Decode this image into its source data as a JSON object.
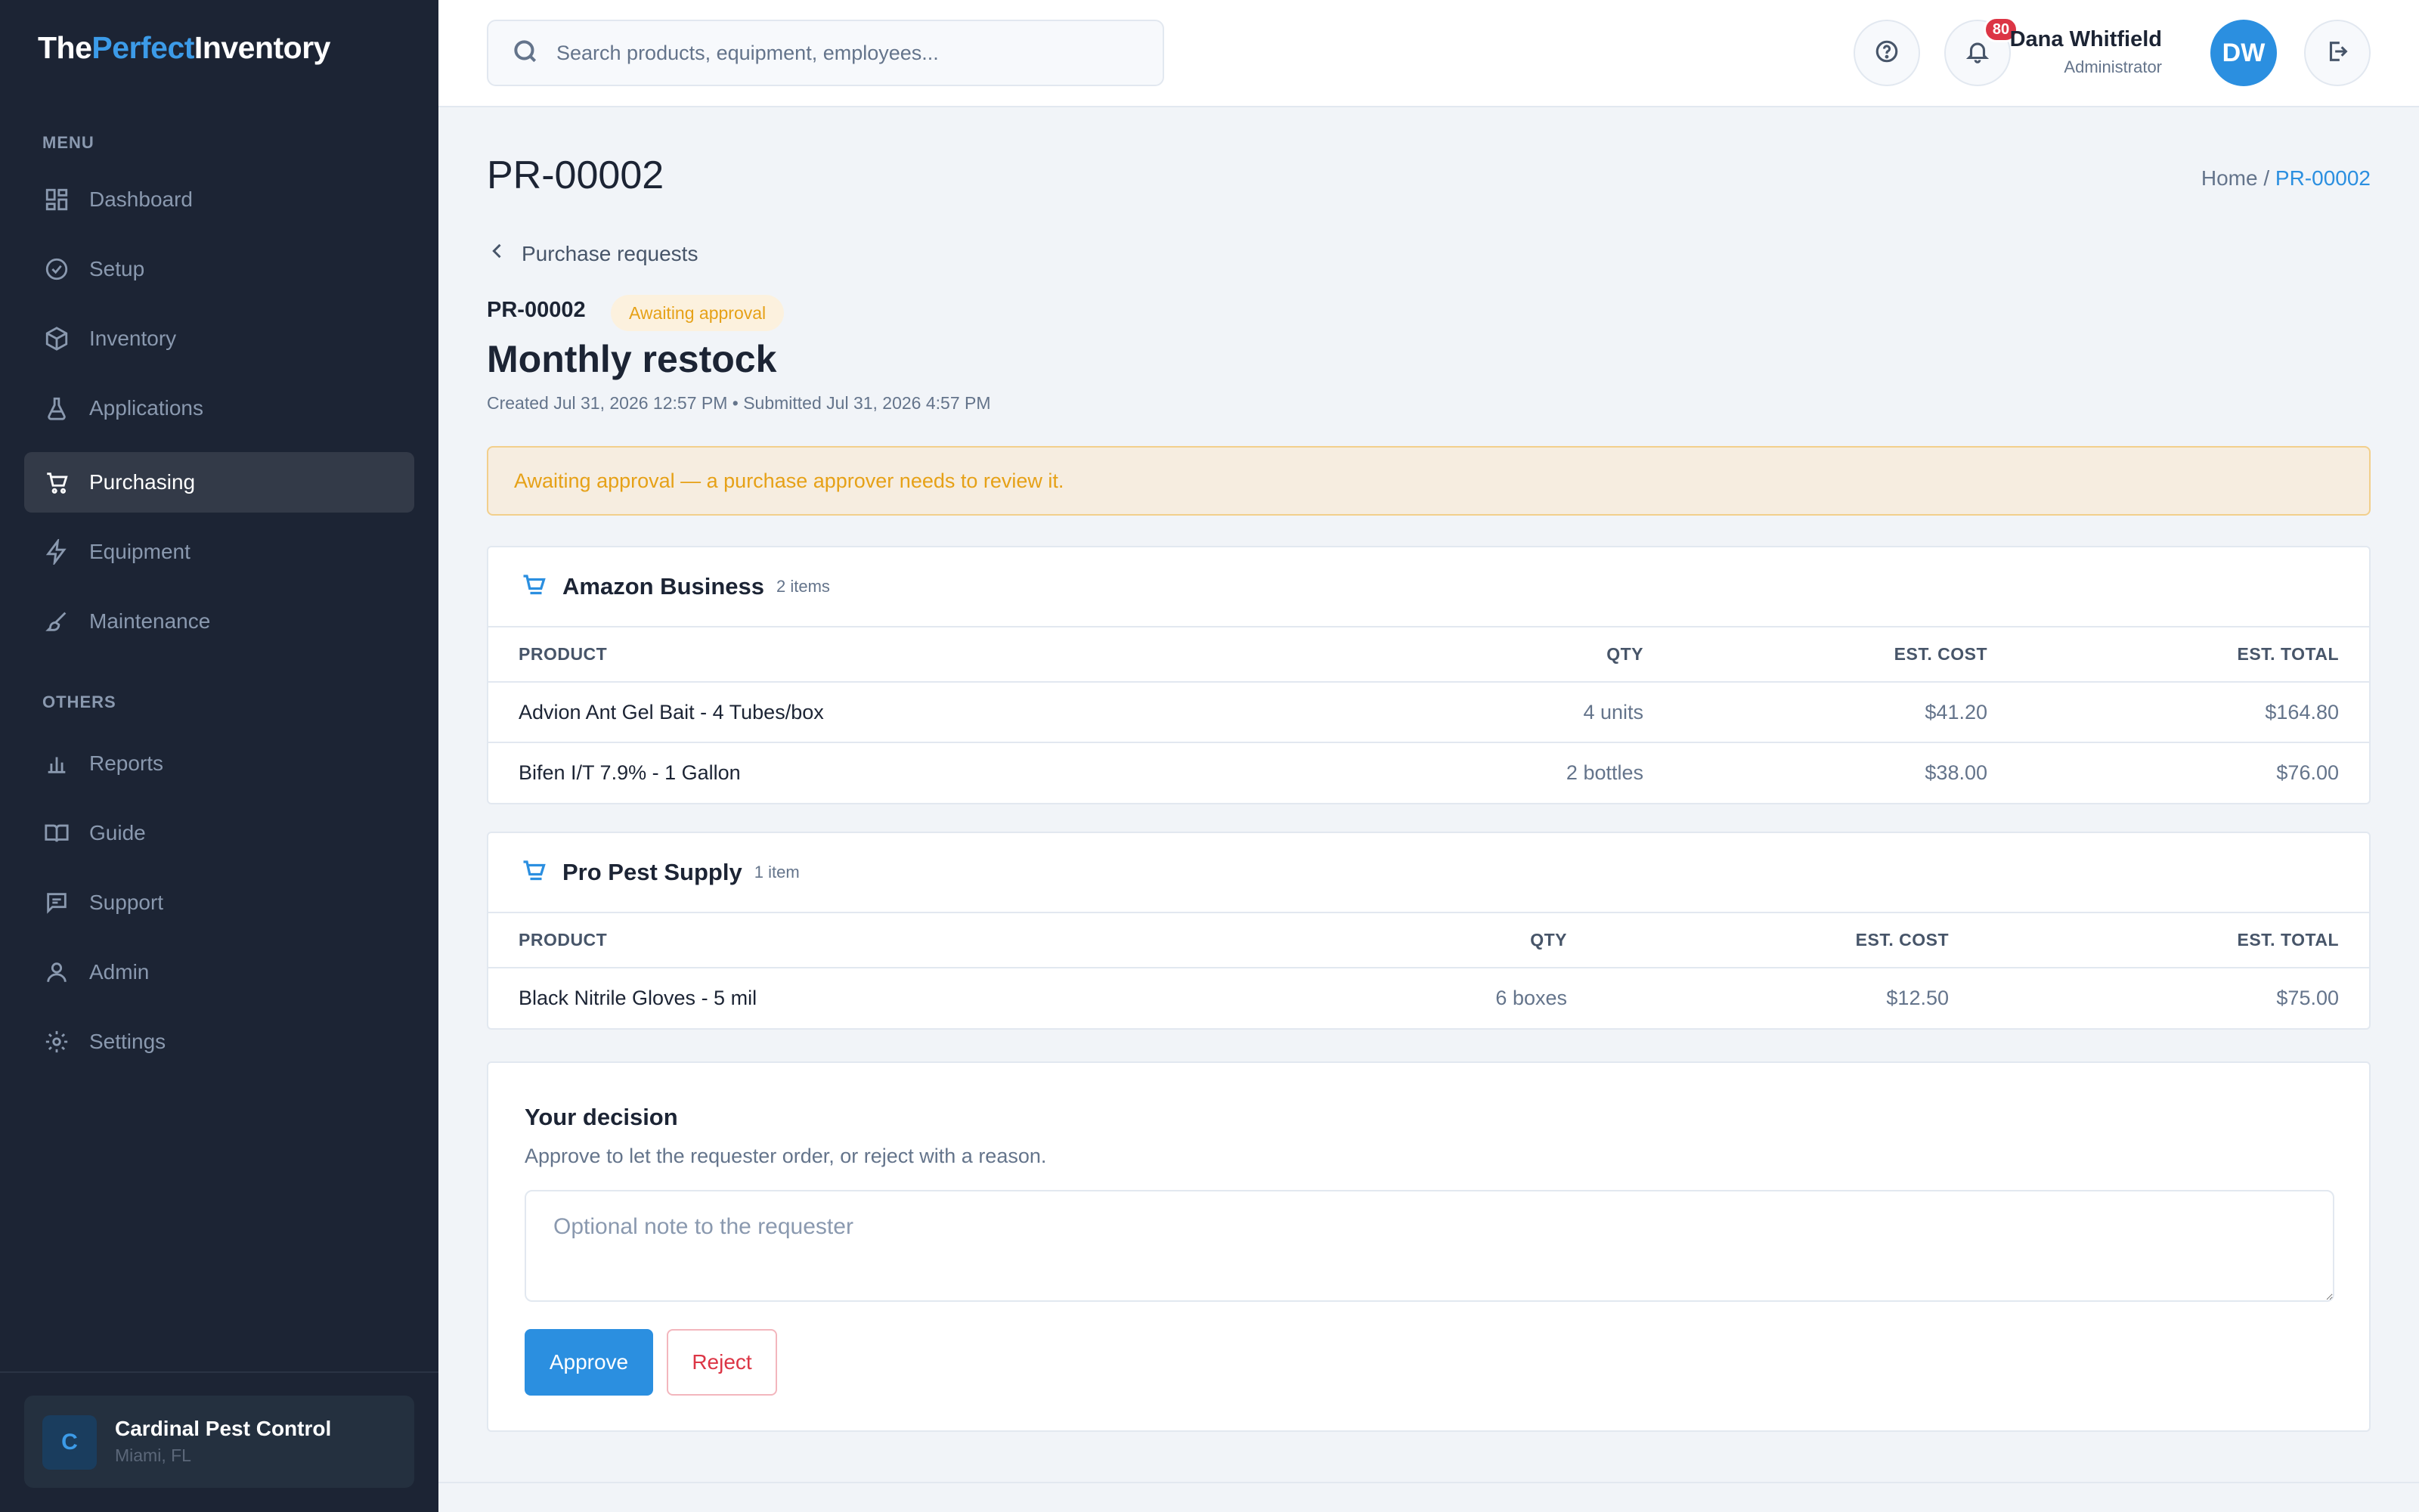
{
  "brand": {
    "part1": "The",
    "part2": "Perfect",
    "part3": "Inventory"
  },
  "sidebar": {
    "menu_label": "MENU",
    "others_label": "OTHERS",
    "items": [
      {
        "label": "Dashboard",
        "icon": "dashboard-icon"
      },
      {
        "label": "Setup",
        "icon": "check-circle-icon"
      },
      {
        "label": "Inventory",
        "icon": "box-icon"
      },
      {
        "label": "Applications",
        "icon": "flask-icon"
      },
      {
        "label": "Purchasing",
        "icon": "cart-icon",
        "active": true
      },
      {
        "label": "Equipment",
        "icon": "lightning-icon"
      },
      {
        "label": "Maintenance",
        "icon": "brush-icon"
      }
    ],
    "others": [
      {
        "label": "Reports",
        "icon": "bar-chart-icon"
      },
      {
        "label": "Guide",
        "icon": "book-icon"
      },
      {
        "label": "Support",
        "icon": "message-icon"
      },
      {
        "label": "Admin",
        "icon": "user-icon"
      },
      {
        "label": "Settings",
        "icon": "gear-icon"
      }
    ],
    "org": {
      "initial": "C",
      "name": "Cardinal Pest Control",
      "location": "Miami, FL"
    }
  },
  "header": {
    "search_placeholder": "Search products, equipment, employees...",
    "notifications_count": "80",
    "user_name": "Dana Whitfield",
    "user_role": "Administrator",
    "user_initials": "DW"
  },
  "page": {
    "title": "PR-00002",
    "breadcrumb_home": "Home /",
    "breadcrumb_current": "PR-00002",
    "back_label": "Purchase requests",
    "pr_code": "PR-00002",
    "status": "Awaiting approval",
    "request_title": "Monthly restock",
    "meta": "Created Jul 31, 2026 12:57 PM • Submitted Jul 31, 2026 4:57 PM",
    "alert": "Awaiting approval — a purchase approver needs to review it."
  },
  "vendors": [
    {
      "name": "Amazon Business",
      "count": "2 items",
      "columns": [
        "PRODUCT",
        "QTY",
        "EST. COST",
        "EST. TOTAL"
      ],
      "rows": [
        [
          "Advion Ant Gel Bait - 4 Tubes/box",
          "4 units",
          "$41.20",
          "$164.80"
        ],
        [
          "Bifen I/T 7.9% - 1 Gallon",
          "2 bottles",
          "$38.00",
          "$76.00"
        ]
      ]
    },
    {
      "name": "Pro Pest Supply",
      "count": "1 item",
      "columns": [
        "PRODUCT",
        "QTY",
        "EST. COST",
        "EST. TOTAL"
      ],
      "rows": [
        [
          "Black Nitrile Gloves - 5 mil",
          "6 boxes",
          "$12.50",
          "$75.00"
        ]
      ]
    }
  ],
  "decision": {
    "title": "Your decision",
    "subtitle": "Approve to let the requester order, or reject with a reason.",
    "note_placeholder": "Optional note to the requester",
    "approve_label": "Approve",
    "reject_label": "Reject"
  },
  "colors": {
    "sidebar_bg": "#1c2434",
    "accent": "#2b8fe0",
    "warning": "#e6a117",
    "danger": "#dc3545"
  }
}
